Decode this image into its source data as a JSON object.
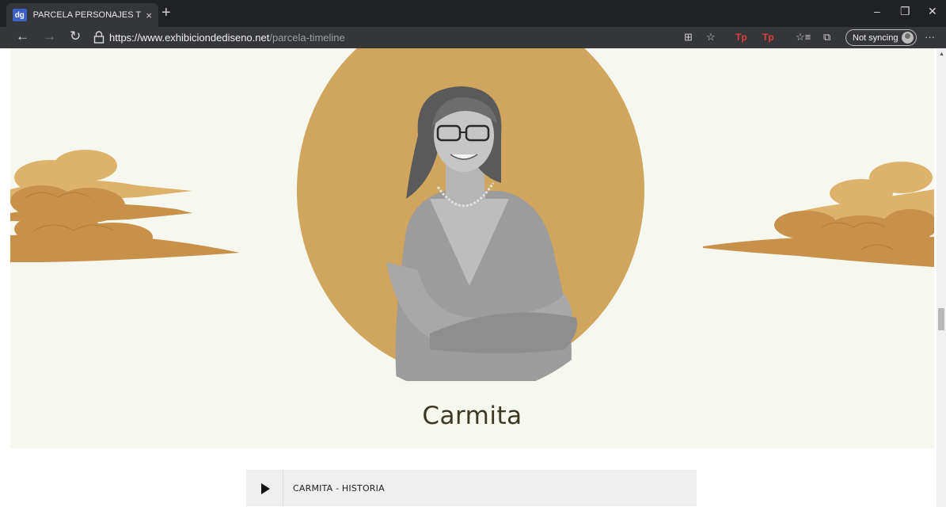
{
  "browser": {
    "tab": {
      "favicon_text": "dg",
      "title": "PARCELA PERSONAJES TIMELINE",
      "close": "×"
    },
    "new_tab": "+",
    "window": {
      "minimize": "–",
      "restore": "❐",
      "close": "✕"
    },
    "nav": {
      "back": "←",
      "forward": "→",
      "refresh": "↻"
    },
    "url": {
      "host": "https://www.exhibiciondediseno.net",
      "path": "/parcela-timeline"
    },
    "toolbar_icons": {
      "read_aloud": "⊞",
      "favorite": "☆",
      "ext1": "Tp",
      "ext2": "Tp",
      "favorites_bar": "☆≡",
      "collections": "⧉",
      "more": "···"
    },
    "sync_label": "Not syncing"
  },
  "page": {
    "person_name": "Carmita",
    "audio": {
      "title": "CARMITA - HISTORIA"
    }
  },
  "colors": {
    "hero_bg": "#f6f7ee",
    "circle": "#d0a55e",
    "cloud_dark": "#c7914a",
    "cloud_light": "#ddb36c",
    "name": "#3d3823"
  }
}
